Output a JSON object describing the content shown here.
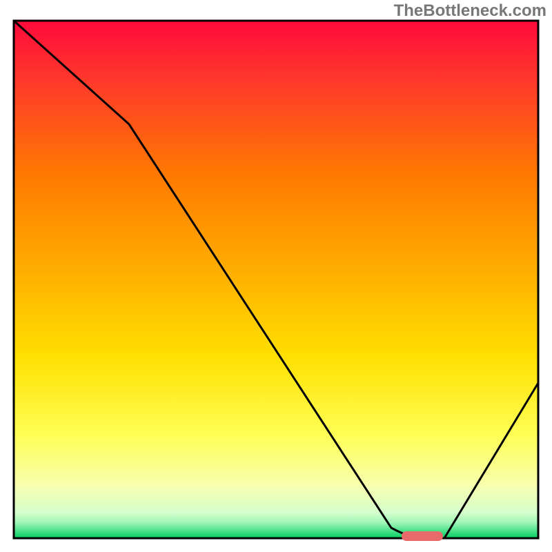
{
  "watermark": "TheBottleneck.com",
  "chart_data": {
    "type": "line",
    "title": "",
    "xlabel": "",
    "ylabel": "",
    "xlim": [
      0,
      100
    ],
    "ylim": [
      0,
      100
    ],
    "background_gradient": {
      "top": "#ff0040",
      "upper_mid": "#ff7a00",
      "mid": "#ffd000",
      "lower_mid": "#ffff66",
      "lower": "#f5ffcc",
      "bottom": "#00d060"
    },
    "series": [
      {
        "name": "bottleneck-curve",
        "x": [
          0,
          22,
          72,
          78,
          82,
          100
        ],
        "y": [
          100,
          80,
          2,
          0,
          0,
          30
        ],
        "stroke": "#000000",
        "stroke_width": 3
      }
    ],
    "marker": {
      "name": "optimal-zone",
      "x_center_pct": 77.5,
      "y_pct": 0,
      "width_pct": 7,
      "color": "#e86a6a"
    },
    "axes": {
      "frame_color": "#000000",
      "frame_width": 3
    }
  }
}
